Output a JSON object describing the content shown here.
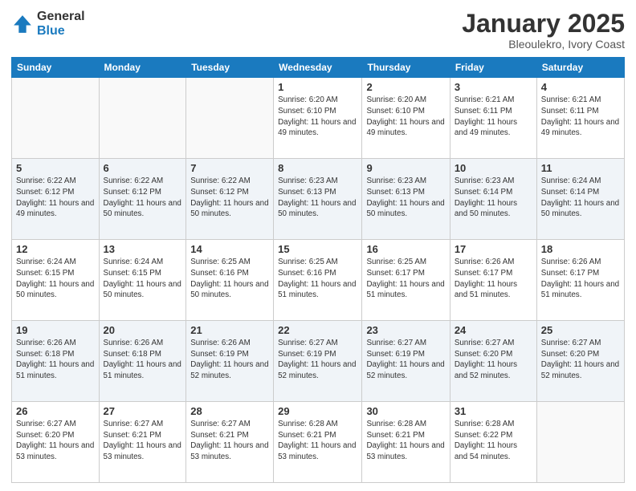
{
  "logo": {
    "general": "General",
    "blue": "Blue"
  },
  "header": {
    "title": "January 2025",
    "subtitle": "Bleoulekro, Ivory Coast"
  },
  "days_of_week": [
    "Sunday",
    "Monday",
    "Tuesday",
    "Wednesday",
    "Thursday",
    "Friday",
    "Saturday"
  ],
  "weeks": [
    [
      {
        "day": "",
        "info": ""
      },
      {
        "day": "",
        "info": ""
      },
      {
        "day": "",
        "info": ""
      },
      {
        "day": "1",
        "info": "Sunrise: 6:20 AM\nSunset: 6:10 PM\nDaylight: 11 hours and 49 minutes."
      },
      {
        "day": "2",
        "info": "Sunrise: 6:20 AM\nSunset: 6:10 PM\nDaylight: 11 hours and 49 minutes."
      },
      {
        "day": "3",
        "info": "Sunrise: 6:21 AM\nSunset: 6:11 PM\nDaylight: 11 hours and 49 minutes."
      },
      {
        "day": "4",
        "info": "Sunrise: 6:21 AM\nSunset: 6:11 PM\nDaylight: 11 hours and 49 minutes."
      }
    ],
    [
      {
        "day": "5",
        "info": "Sunrise: 6:22 AM\nSunset: 6:12 PM\nDaylight: 11 hours and 49 minutes."
      },
      {
        "day": "6",
        "info": "Sunrise: 6:22 AM\nSunset: 6:12 PM\nDaylight: 11 hours and 50 minutes."
      },
      {
        "day": "7",
        "info": "Sunrise: 6:22 AM\nSunset: 6:12 PM\nDaylight: 11 hours and 50 minutes."
      },
      {
        "day": "8",
        "info": "Sunrise: 6:23 AM\nSunset: 6:13 PM\nDaylight: 11 hours and 50 minutes."
      },
      {
        "day": "9",
        "info": "Sunrise: 6:23 AM\nSunset: 6:13 PM\nDaylight: 11 hours and 50 minutes."
      },
      {
        "day": "10",
        "info": "Sunrise: 6:23 AM\nSunset: 6:14 PM\nDaylight: 11 hours and 50 minutes."
      },
      {
        "day": "11",
        "info": "Sunrise: 6:24 AM\nSunset: 6:14 PM\nDaylight: 11 hours and 50 minutes."
      }
    ],
    [
      {
        "day": "12",
        "info": "Sunrise: 6:24 AM\nSunset: 6:15 PM\nDaylight: 11 hours and 50 minutes."
      },
      {
        "day": "13",
        "info": "Sunrise: 6:24 AM\nSunset: 6:15 PM\nDaylight: 11 hours and 50 minutes."
      },
      {
        "day": "14",
        "info": "Sunrise: 6:25 AM\nSunset: 6:16 PM\nDaylight: 11 hours and 50 minutes."
      },
      {
        "day": "15",
        "info": "Sunrise: 6:25 AM\nSunset: 6:16 PM\nDaylight: 11 hours and 51 minutes."
      },
      {
        "day": "16",
        "info": "Sunrise: 6:25 AM\nSunset: 6:17 PM\nDaylight: 11 hours and 51 minutes."
      },
      {
        "day": "17",
        "info": "Sunrise: 6:26 AM\nSunset: 6:17 PM\nDaylight: 11 hours and 51 minutes."
      },
      {
        "day": "18",
        "info": "Sunrise: 6:26 AM\nSunset: 6:17 PM\nDaylight: 11 hours and 51 minutes."
      }
    ],
    [
      {
        "day": "19",
        "info": "Sunrise: 6:26 AM\nSunset: 6:18 PM\nDaylight: 11 hours and 51 minutes."
      },
      {
        "day": "20",
        "info": "Sunrise: 6:26 AM\nSunset: 6:18 PM\nDaylight: 11 hours and 51 minutes."
      },
      {
        "day": "21",
        "info": "Sunrise: 6:26 AM\nSunset: 6:19 PM\nDaylight: 11 hours and 52 minutes."
      },
      {
        "day": "22",
        "info": "Sunrise: 6:27 AM\nSunset: 6:19 PM\nDaylight: 11 hours and 52 minutes."
      },
      {
        "day": "23",
        "info": "Sunrise: 6:27 AM\nSunset: 6:19 PM\nDaylight: 11 hours and 52 minutes."
      },
      {
        "day": "24",
        "info": "Sunrise: 6:27 AM\nSunset: 6:20 PM\nDaylight: 11 hours and 52 minutes."
      },
      {
        "day": "25",
        "info": "Sunrise: 6:27 AM\nSunset: 6:20 PM\nDaylight: 11 hours and 52 minutes."
      }
    ],
    [
      {
        "day": "26",
        "info": "Sunrise: 6:27 AM\nSunset: 6:20 PM\nDaylight: 11 hours and 53 minutes."
      },
      {
        "day": "27",
        "info": "Sunrise: 6:27 AM\nSunset: 6:21 PM\nDaylight: 11 hours and 53 minutes."
      },
      {
        "day": "28",
        "info": "Sunrise: 6:27 AM\nSunset: 6:21 PM\nDaylight: 11 hours and 53 minutes."
      },
      {
        "day": "29",
        "info": "Sunrise: 6:28 AM\nSunset: 6:21 PM\nDaylight: 11 hours and 53 minutes."
      },
      {
        "day": "30",
        "info": "Sunrise: 6:28 AM\nSunset: 6:21 PM\nDaylight: 11 hours and 53 minutes."
      },
      {
        "day": "31",
        "info": "Sunrise: 6:28 AM\nSunset: 6:22 PM\nDaylight: 11 hours and 54 minutes."
      },
      {
        "day": "",
        "info": ""
      }
    ]
  ]
}
